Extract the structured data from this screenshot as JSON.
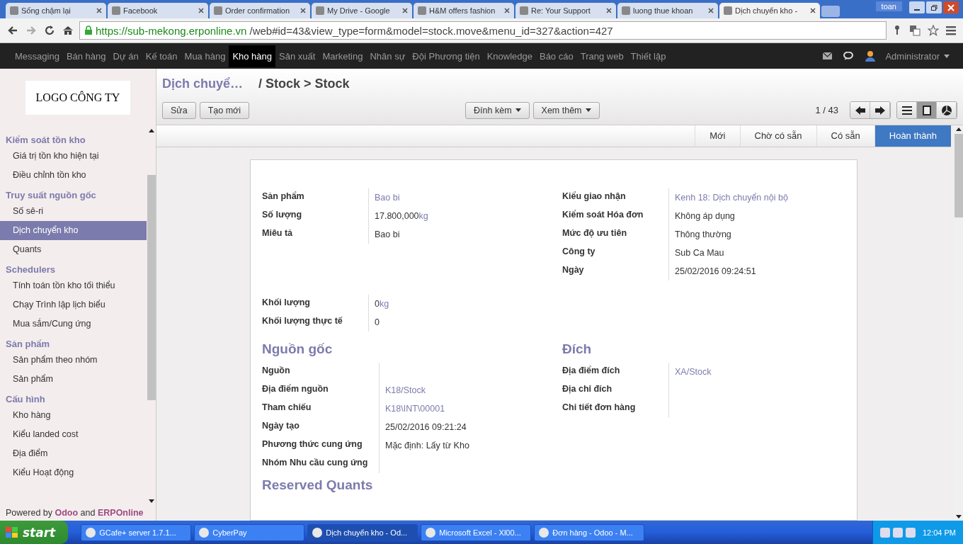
{
  "browser": {
    "tabs": [
      {
        "title": "Sống chậm lại",
        "selected": false
      },
      {
        "title": "Facebook",
        "selected": false
      },
      {
        "title": "Order confirmation",
        "selected": false
      },
      {
        "title": "My Drive - Google",
        "selected": false
      },
      {
        "title": "H&M offers fashion",
        "selected": false
      },
      {
        "title": "Re: Your Support",
        "selected": false
      },
      {
        "title": "luong thue khoan",
        "selected": false
      },
      {
        "title": "Dịch chuyển kho -",
        "selected": true
      }
    ],
    "user": "toan",
    "url_host": "https://sub-mekong.erponline.vn",
    "url_path": "/web#id=43&view_type=form&model=stock.move&menu_id=327&action=427"
  },
  "topnav": {
    "items": [
      {
        "label": "Messaging",
        "selected": false
      },
      {
        "label": "Bán hàng",
        "selected": false
      },
      {
        "label": "Dự án",
        "selected": false
      },
      {
        "label": "Kế toán",
        "selected": false
      },
      {
        "label": "Mua hàng",
        "selected": false
      },
      {
        "label": "Kho hàng",
        "selected": true
      },
      {
        "label": "Sản xuất",
        "selected": false
      },
      {
        "label": "Marketing",
        "selected": false
      },
      {
        "label": "Nhân sự",
        "selected": false
      },
      {
        "label": "Đội Phương tiện",
        "selected": false
      },
      {
        "label": "Knowledge",
        "selected": false
      },
      {
        "label": "Báo cáo",
        "selected": false
      },
      {
        "label": "Trang web",
        "selected": false
      },
      {
        "label": "Thiết lập",
        "selected": false
      }
    ],
    "user": "Administrator"
  },
  "sidebar": {
    "logo": "LOGO CÔNG TY",
    "sections": [
      {
        "title": "Kiểm soát tồn kho",
        "items": [
          {
            "label": "Giá trị tồn kho hiện tại",
            "selected": false
          },
          {
            "label": "Điều chỉnh tồn kho",
            "selected": false
          }
        ]
      },
      {
        "title": "Truy suất nguồn gốc",
        "items": [
          {
            "label": "Số sê-ri",
            "selected": false
          },
          {
            "label": "Dịch chuyển kho",
            "selected": true
          },
          {
            "label": "Quants",
            "selected": false
          }
        ]
      },
      {
        "title": "Schedulers",
        "items": [
          {
            "label": "Tính toán tồn kho tối thiểu",
            "selected": false
          },
          {
            "label": "Chạy Trình lập lịch biểu",
            "selected": false
          },
          {
            "label": "Mua sắm/Cung ứng",
            "selected": false
          }
        ]
      },
      {
        "title": "Sản phẩm",
        "items": [
          {
            "label": "Sản phẩm theo nhóm",
            "selected": false
          },
          {
            "label": "Sản phẩm",
            "selected": false
          }
        ]
      },
      {
        "title": "Cấu hình",
        "items": [
          {
            "label": "Kho hàng",
            "selected": false
          },
          {
            "label": "Kiểu landed cost",
            "selected": false
          },
          {
            "label": "Địa điểm",
            "selected": false
          },
          {
            "label": "Kiểu Hoạt động",
            "selected": false
          }
        ]
      }
    ],
    "footer": "Powered by **Odoo** and **ERPOnline**"
  },
  "breadcrumb": {
    "parent": "Dịch chuyể…",
    "current": "/ Stock > Stock"
  },
  "buttons": {
    "left": [
      "Sửa",
      "Tạo mới"
    ],
    "middle": [
      "Đính kèm",
      "Xem thêm"
    ]
  },
  "pager": "1 / 43",
  "stages": [
    {
      "label": "Mới",
      "selected": false
    },
    {
      "label": "Chờ có sẵn",
      "selected": false
    },
    {
      "label": "Có sẵn",
      "selected": false
    },
    {
      "label": "Hoàn thành",
      "selected": true
    }
  ],
  "form": {
    "top_left": [
      {
        "label": "Sản phẩm",
        "value": "Bao bi",
        "link": true
      },
      {
        "label": "Số lượng",
        "value": "17.800,000",
        "unit": "kg",
        "link": false
      },
      {
        "label": "Miêu tả",
        "value": "Bao bi",
        "link": false
      }
    ],
    "top_right": [
      {
        "label": "Kiểu giao nhận",
        "value": "Kenh 18: Dịch chuyển nội bộ",
        "link": true
      },
      {
        "label": "Kiểm soát Hóa đơn",
        "value": "Không áp dụng",
        "link": false
      },
      {
        "label": "Mức độ ưu tiên",
        "value": "Thông thường",
        "link": false
      },
      {
        "label": "Công ty",
        "value": "Sub Ca Mau",
        "link": false
      },
      {
        "label": "Ngày",
        "value": "25/02/2016 09:24:51",
        "link": false
      }
    ],
    "weight": [
      {
        "label": "Khối lượng",
        "value": "0",
        "unit": "kg",
        "link": false
      },
      {
        "label": "Khối lượng thực tế",
        "value": "0",
        "link": false
      }
    ],
    "source": {
      "title": "Nguồn gốc",
      "fields": [
        {
          "label": "Nguồn"
        },
        {
          "label": "Địa điểm nguồn",
          "value": "K18/Stock",
          "link": true
        },
        {
          "label": "Tham chiếu",
          "value": "K18\\INT\\00001",
          "link": true
        },
        {
          "label": "Ngày tạo",
          "value": "25/02/2016 09:21:24",
          "link": false
        },
        {
          "label": "Phương thức cung ứng",
          "value": "Mặc định: Lấy từ Kho",
          "link": false
        },
        {
          "label": "Nhóm Nhu cầu cung ứng"
        }
      ]
    },
    "dest": {
      "title": "Đích",
      "fields": [
        {
          "label": "Địa điểm đích",
          "value": "XA/Stock",
          "link": true
        },
        {
          "label": "Địa chỉ đích"
        },
        {
          "label": "Chi tiết đơn hàng"
        }
      ]
    },
    "next_section": "Reserved Quants"
  },
  "taskbar": {
    "start": "start",
    "tasks": [
      {
        "label": "GCafe+ server 1.7.1...",
        "selected": false
      },
      {
        "label": "CyberPay",
        "selected": false
      },
      {
        "label": "Dịch chuyển kho - Od...",
        "selected": true
      },
      {
        "label": "Microsoft Excel - Xl00...",
        "selected": false
      },
      {
        "label": "Đơn hàng - Odoo - M...",
        "selected": false
      }
    ],
    "time": "12:04 PM"
  }
}
